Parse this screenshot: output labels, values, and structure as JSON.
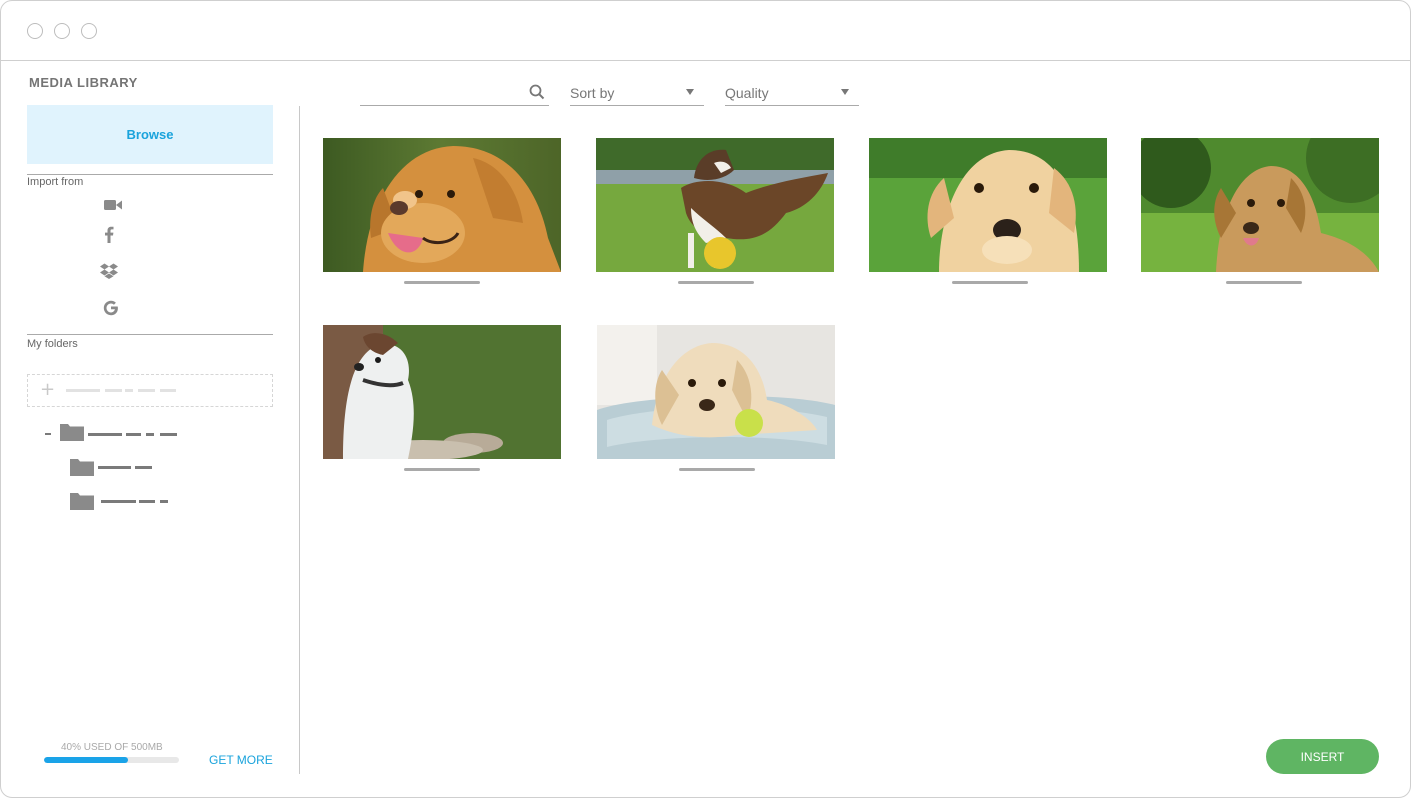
{
  "window": {
    "controls": [
      "close",
      "minimize",
      "maximize"
    ]
  },
  "sidebar": {
    "title": "MEDIA LIBRARY",
    "browse_label": "Browse",
    "import_label": "Import from",
    "import_sources": [
      "video-camera-icon",
      "facebook-icon",
      "dropbox-icon",
      "google-icon"
    ],
    "folders_label": "My folders",
    "usage_text": "40% USED OF 500MB",
    "usage_fraction": 0.62,
    "get_more_label": "GET MORE"
  },
  "toolbar": {
    "search_placeholder": "",
    "sort_label": "Sort by",
    "quality_label": "Quality"
  },
  "images": [
    {
      "subject": "golden retriever with tongue out"
    },
    {
      "subject": "collie with yellow ball on grass"
    },
    {
      "subject": "yellow labrador puppy in grass"
    },
    {
      "subject": "golden retriever in green garden"
    },
    {
      "subject": "jack russell terrier sitting"
    },
    {
      "subject": "golden retriever with tennis ball on cushion"
    }
  ],
  "actions": {
    "insert_label": "INSERT"
  },
  "colors": {
    "accent": "#1aa3dc",
    "browse_bg": "#e0f3fd",
    "insert": "#5fb563"
  }
}
